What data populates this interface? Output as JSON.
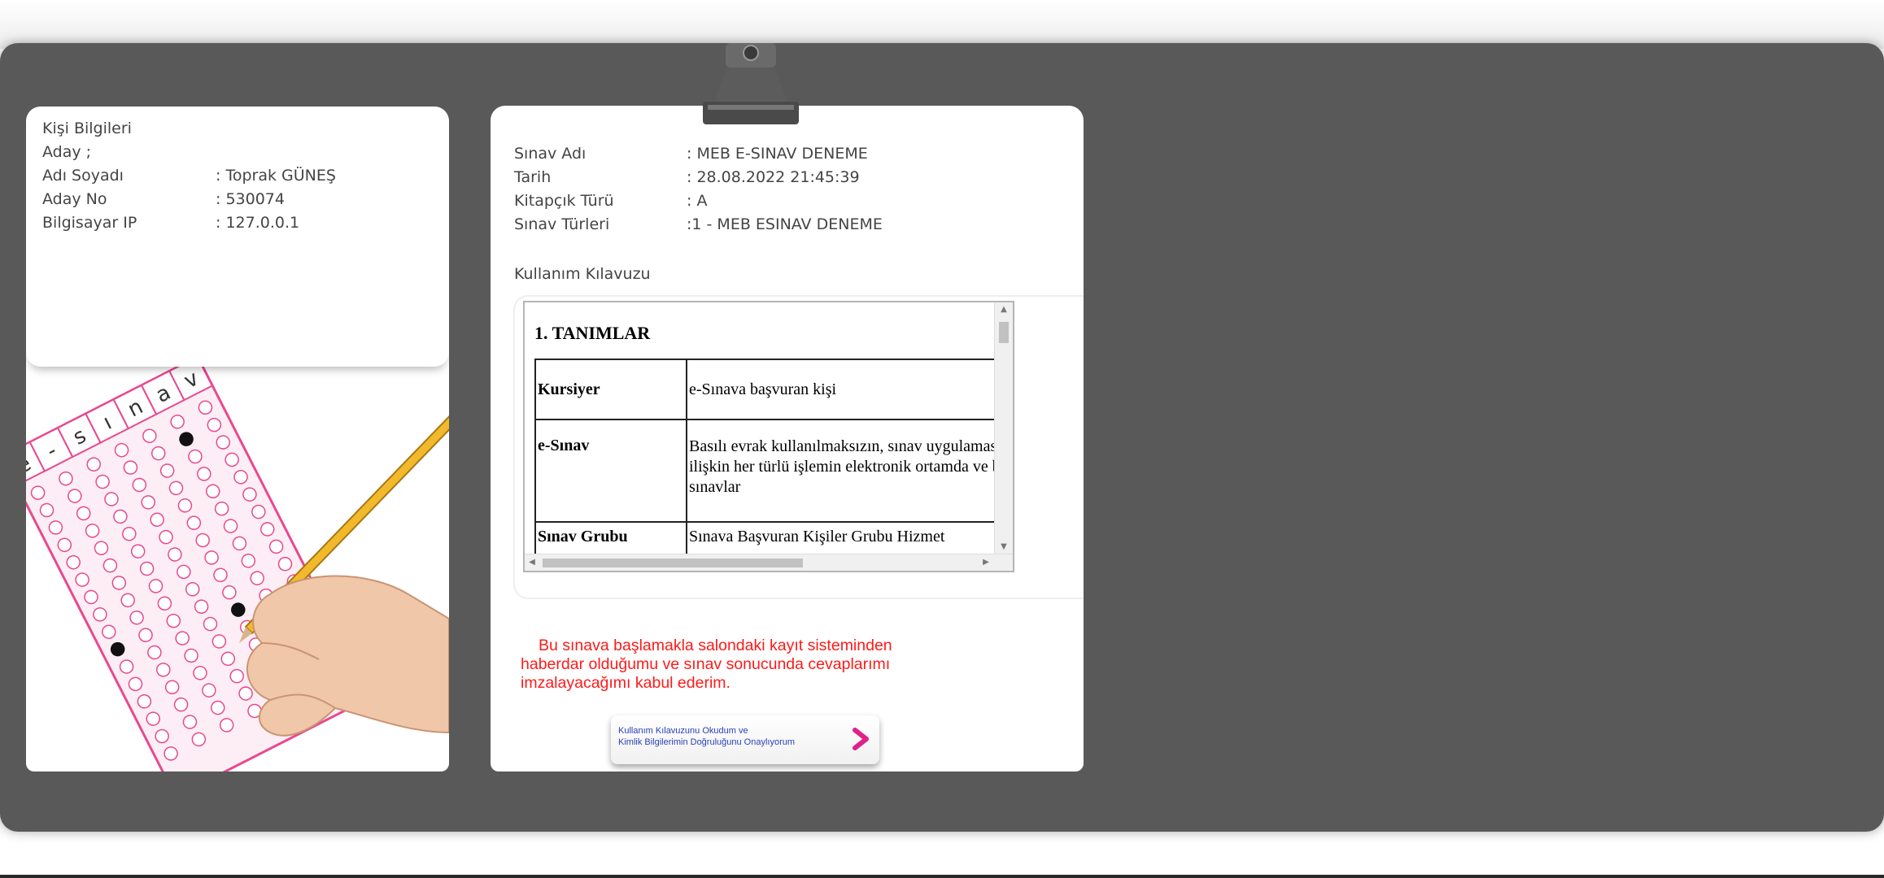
{
  "person": {
    "section_title": "Kişi Bilgileri",
    "aday_label": "Aday ;",
    "fields": [
      {
        "label": "Adı Soyadı",
        "value": ": Toprak GÜNEŞ"
      },
      {
        "label": "Aday No",
        "value": ": 530074"
      },
      {
        "label": "Bilgisayar IP",
        "value": ": 127.0.0.1"
      }
    ]
  },
  "illustration": {
    "sheet_letters": [
      "e",
      "-",
      "s",
      "ı",
      "n",
      "a",
      "v"
    ]
  },
  "exam": {
    "fields": [
      {
        "label": "Sınav Adı",
        "value": ": MEB E-SINAV DENEME"
      },
      {
        "label": "Tarih",
        "value": ": 28.08.2022 21:45:39"
      },
      {
        "label": "Kitapçık Türü",
        "value": ": A"
      },
      {
        "label": "Sınav Türleri",
        "value": ":1 - MEB ESINAV DENEME"
      }
    ],
    "guide_title": "Kullanım Kılavuzu"
  },
  "guide_doc": {
    "heading": "1. TANIMLAR",
    "rows": [
      {
        "term": "Kursiyer",
        "definition": "e-Sınava başvuran kişi"
      },
      {
        "term": "e-Sınav",
        "definition": "Basılı evrak kullanılmaksızın, sınav uygulamasına ilişkin her türlü işlemin elektronik ortamda ve b sınavlar"
      },
      {
        "term": "Sınav Grubu",
        "definition": "Sınava Başvuran Kişiler Grubu Hizmet"
      }
    ]
  },
  "consent_text": "Bu sınava başlamakla salondaki kayıt sisteminden haberdar olduğumu ve sınav sonucunda cevaplarımı imzalayacağımı kabul ederim.",
  "confirm_button": {
    "line1": "Kullanım Kılavuzunu Okudum ve",
    "line2": "Kimlik Bilgilerimin Doğruluğunu Onaylıyorum"
  },
  "colors": {
    "stage_bg": "#595959",
    "consent_text": "#ff1a1a",
    "button_text": "#2a3fb8",
    "chevron": "#e0218a",
    "sheet_pink": "#e9488f"
  }
}
